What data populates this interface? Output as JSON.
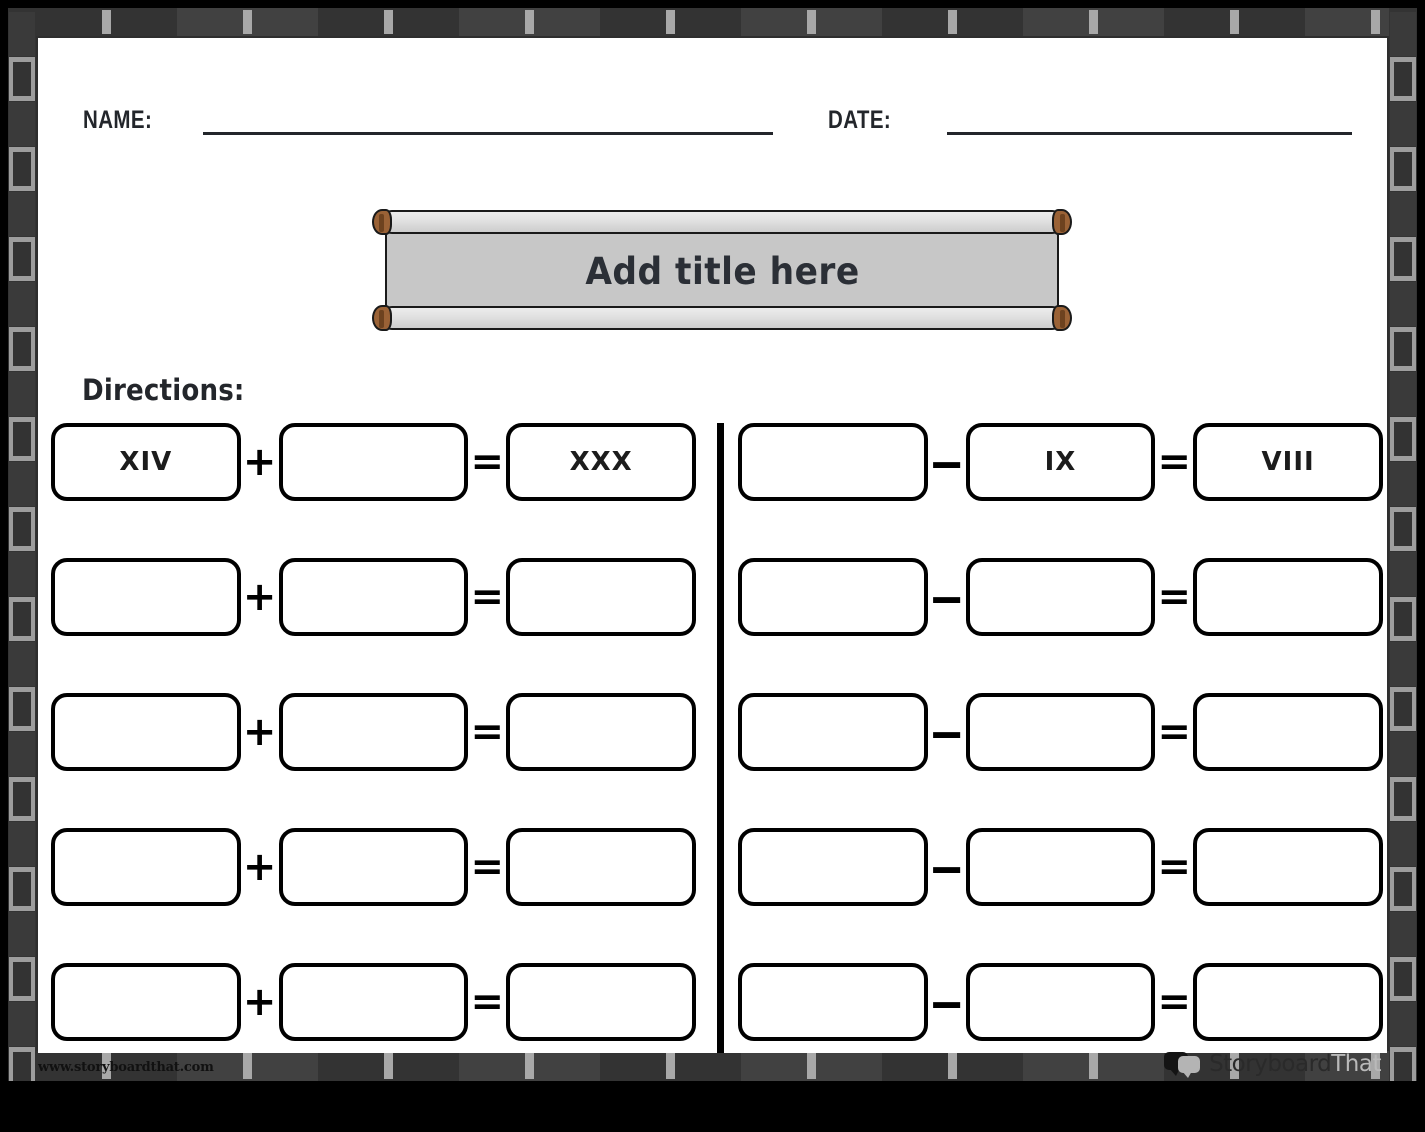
{
  "worksheet": {
    "header": {
      "name_label": "NAME:",
      "date_label": "DATE:"
    },
    "title_banner": {
      "title": "Add title here"
    },
    "directions_label": "Directions:",
    "operators": {
      "plus": "+",
      "minus": "‒",
      "equals": "="
    },
    "columns": [
      {
        "id": "addition",
        "operator": "plus",
        "rows": [
          {
            "a": "XIV",
            "b": "",
            "result": "XXX"
          },
          {
            "a": "",
            "b": "",
            "result": ""
          },
          {
            "a": "",
            "b": "",
            "result": ""
          },
          {
            "a": "",
            "b": "",
            "result": ""
          },
          {
            "a": "",
            "b": "",
            "result": ""
          }
        ]
      },
      {
        "id": "subtraction",
        "operator": "minus",
        "rows": [
          {
            "a": "",
            "b": "IX",
            "result": "VIII"
          },
          {
            "a": "",
            "b": "",
            "result": ""
          },
          {
            "a": "",
            "b": "",
            "result": ""
          },
          {
            "a": "",
            "b": "",
            "result": ""
          },
          {
            "a": "",
            "b": "",
            "result": ""
          }
        ]
      }
    ],
    "footer": {
      "url": "www.storyboardthat.com",
      "logo_text_primary": "Storyboard",
      "logo_text_secondary": "That"
    },
    "colors": {
      "frame_dark": "#333333",
      "frame_sprocket": "#a8a8a8",
      "paper": "#ffffff",
      "ink": "#000000",
      "banner_body": "#c7c7c7",
      "banner_rod": "#e2e2e2",
      "knob_wood": "#9a6236"
    }
  }
}
